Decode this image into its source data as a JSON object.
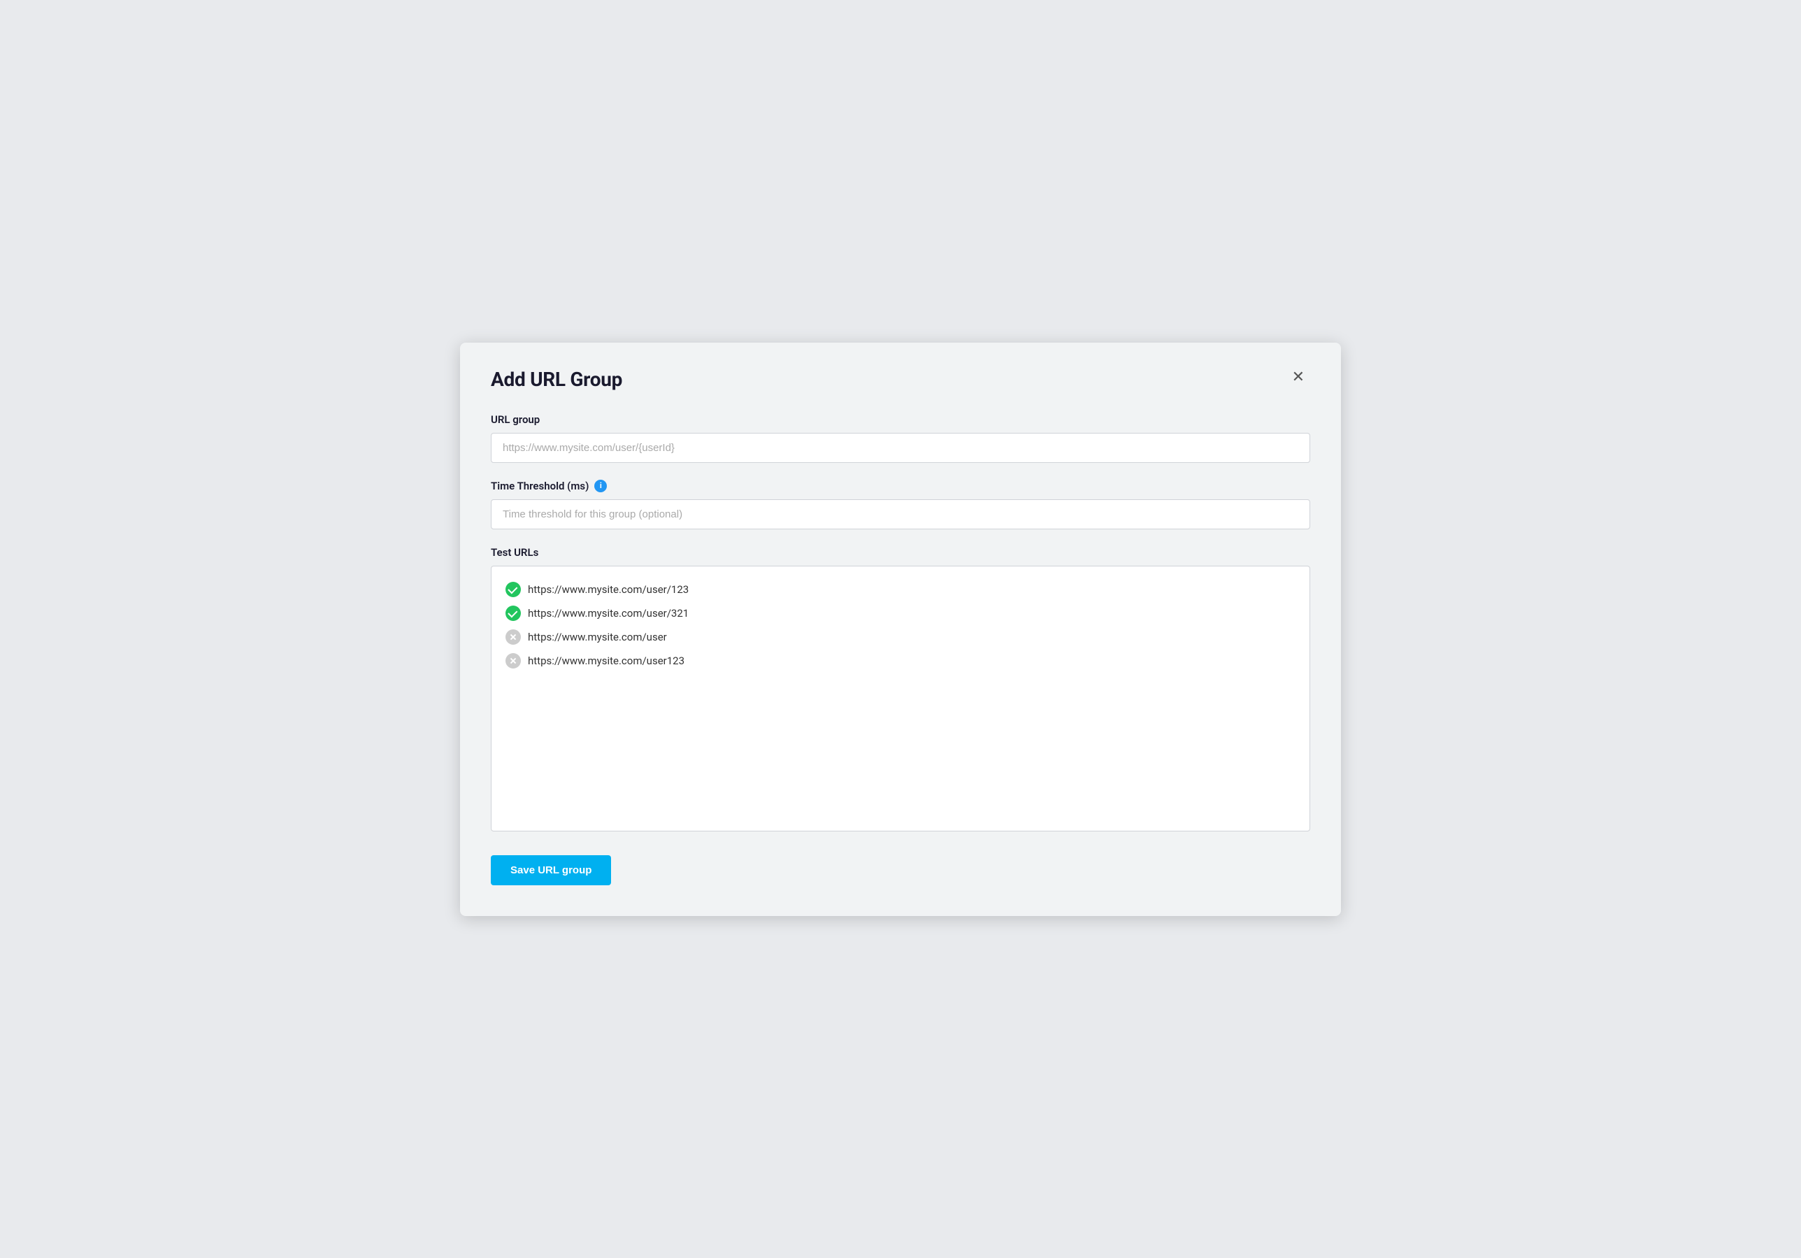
{
  "modal": {
    "title": "Add URL Group",
    "close_label": "✕"
  },
  "form": {
    "url_group_label": "URL group",
    "url_group_placeholder": "https://www.mysite.com/user/{userId}",
    "time_threshold_label": "Time Threshold (ms)",
    "time_threshold_placeholder": "Time threshold for this group (optional)",
    "test_urls_label": "Test URLs",
    "save_button_label": "Save URL group"
  },
  "test_urls": [
    {
      "url": "https://www.mysite.com/user/123",
      "status": "match"
    },
    {
      "url": "https://www.mysite.com/user/321",
      "status": "match"
    },
    {
      "url": "https://www.mysite.com/user",
      "status": "no-match"
    },
    {
      "url": "https://www.mysite.com/user123",
      "status": "no-match"
    }
  ],
  "icons": {
    "info": "i",
    "close": "✕"
  }
}
